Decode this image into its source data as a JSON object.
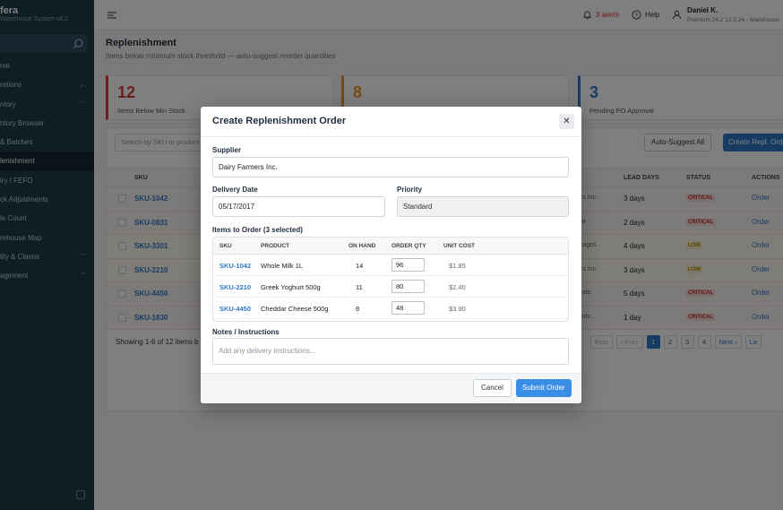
{
  "app": {
    "name": "fera",
    "subtitle": "Warehouse System v4.2"
  },
  "sidebar": {
    "items": [
      {
        "label": "me",
        "chevron": false,
        "active": false
      },
      {
        "label": "rations",
        "chevron": true,
        "active": false
      },
      {
        "label": "ntory",
        "chevron": true,
        "active": false
      },
      {
        "label": "ntory Browser",
        "chevron": false,
        "active": false
      },
      {
        "label": "& Batches",
        "chevron": false,
        "active": false
      },
      {
        "label": "lenishment",
        "chevron": false,
        "active": true
      },
      {
        "label": "iry / FEFO",
        "chevron": false,
        "active": false
      },
      {
        "label": "ck Adjustments",
        "chevron": false,
        "active": false
      },
      {
        "label": "le Count",
        "chevron": false,
        "active": false
      },
      {
        "label": "rehouse Map",
        "chevron": false,
        "active": false
      },
      {
        "label": "lity & Claims",
        "chevron": true,
        "active": false
      },
      {
        "label": "agement",
        "chevron": true,
        "active": false
      }
    ]
  },
  "topbar": {
    "alerts": "3 alerts",
    "help": "Help",
    "user_name": "Daniel K.",
    "user_role": "Premium 24.2 12.3.24 · Warehouse"
  },
  "page": {
    "title": "Replenishment",
    "subtitle": "Items below minimum stock threshold — auto-suggest reorder quantities"
  },
  "stats": [
    {
      "value": "12",
      "label": "Items Below Min Stock",
      "color": "#d63939"
    },
    {
      "value": "8",
      "label": "",
      "color": "#e8962c"
    },
    {
      "value": "3",
      "label": "Pending PO Approval",
      "color": "#2e78c7"
    }
  ],
  "table": {
    "search_placeholder": "Search by SKU or product",
    "auto_suggest": "Auto-Suggest All",
    "create": "Create Repl. Order",
    "headers": {
      "sku": "SKU",
      "lead": "LEAD DAYS",
      "status": "STATUS",
      "actions": "ACTIONS"
    },
    "rows": [
      {
        "sku": "SKU-1042",
        "supplier": "rs Inc.",
        "lead": "3 days",
        "status": "CRITICAL",
        "action": "Order"
      },
      {
        "sku": "SKU-0831",
        "supplier": "at",
        "lead": "2 days",
        "status": "CRITICAL",
        "action": "Order"
      },
      {
        "sku": "SKU-3301",
        "supplier": "rages",
        "lead": "4 days",
        "status": "LOW",
        "action": "Order"
      },
      {
        "sku": "SKU-2210",
        "supplier": "rs Inc.",
        "lead": "3 days",
        "status": "LOW",
        "action": "Order"
      },
      {
        "sku": "SKU-4450",
        "supplier": "ods",
        "lead": "5 days",
        "status": "CRITICAL",
        "action": "Order"
      },
      {
        "sku": "SKU-1830",
        "supplier": "ods",
        "lead": "1 day",
        "status": "CRITICAL",
        "action": "Order"
      }
    ],
    "showing": "Showing 1-6 of 12 items b",
    "pager": {
      "first": "First",
      "prev": "‹ Prev",
      "pages": [
        "1",
        "2",
        "3",
        "4"
      ],
      "next": "Next ›",
      "last": "La"
    }
  },
  "modal": {
    "title": "Create Replenishment Order",
    "supplier_label": "Supplier",
    "supplier_value": "Dairy Farmers Inc.",
    "date_label": "Delivery Date",
    "date_value": "05/17/2017",
    "priority_label": "Priority",
    "priority_value": "Standard",
    "items_label": "Items to Order (3 selected)",
    "item_headers": {
      "sku": "SKU",
      "product": "PRODUCT",
      "on_hand": "ON HAND",
      "qty": "ORDER QTY",
      "cost": "UNIT COST"
    },
    "items": [
      {
        "sku": "SKU-1042",
        "product": "Whole Milk 1L",
        "on_hand": "14",
        "qty": "96",
        "cost": "$1.85"
      },
      {
        "sku": "SKU-2210",
        "product": "Greek Yoghurt 500g",
        "on_hand": "11",
        "qty": "80",
        "cost": "$2.40"
      },
      {
        "sku": "SKU-4450",
        "product": "Cheddar Cheese 500g",
        "on_hand": "8",
        "qty": "48",
        "cost": "$3.90"
      }
    ],
    "notes_label": "Notes / Instructions",
    "notes_placeholder": "Add any delivery instructions...",
    "cancel": "Cancel",
    "submit": "Submit Order",
    "close": "✕"
  }
}
